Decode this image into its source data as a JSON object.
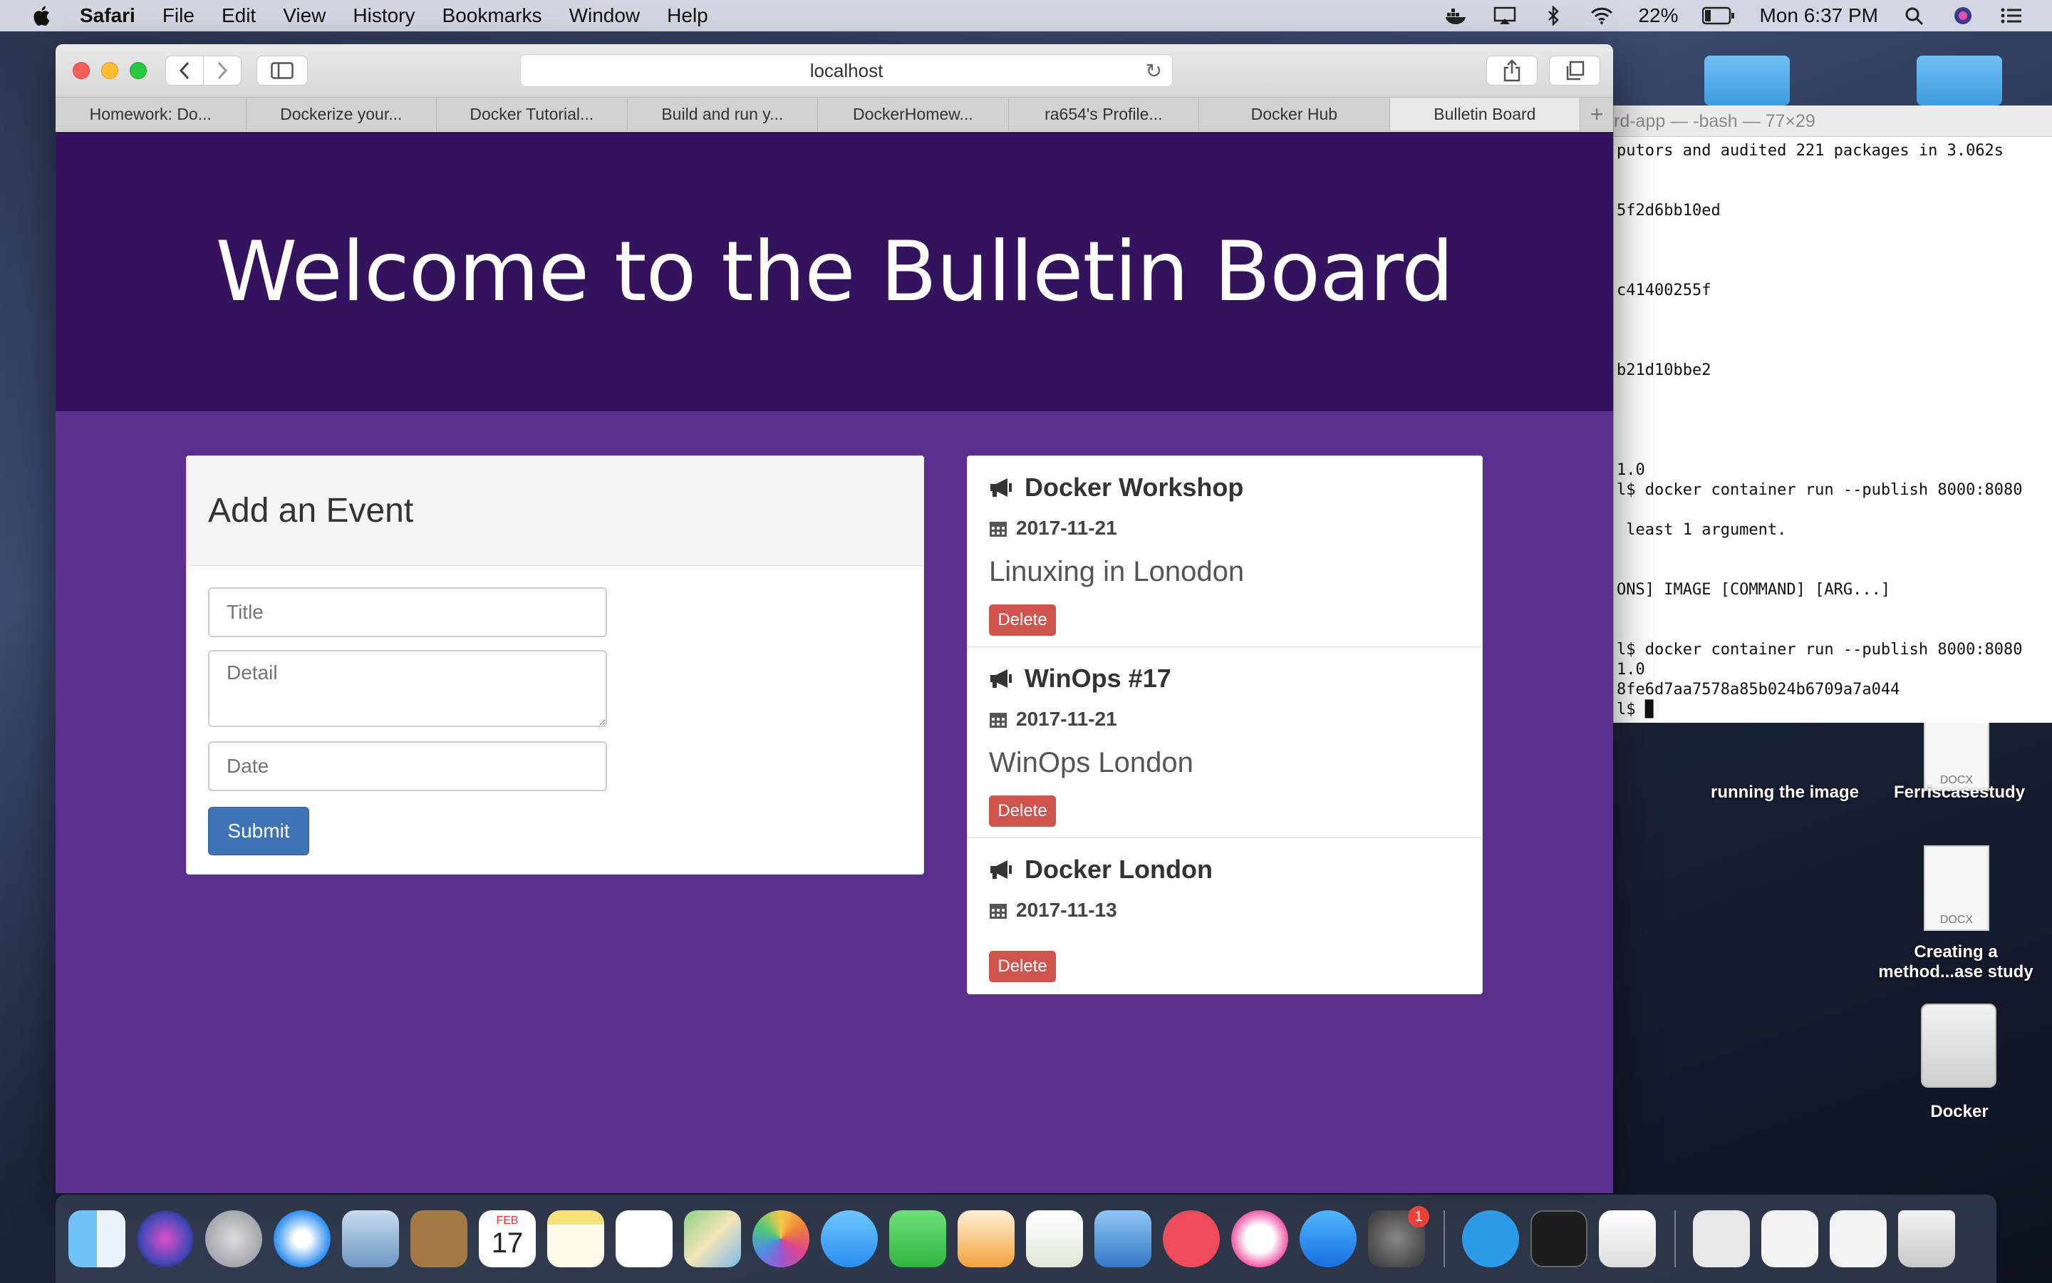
{
  "menubar": {
    "app_name": "Safari",
    "items": [
      "File",
      "Edit",
      "View",
      "History",
      "Bookmarks",
      "Window",
      "Help"
    ],
    "battery": "22%",
    "clock": "Mon 6:37 PM"
  },
  "desktop": {
    "items": [
      "running the image",
      "Ferriscasestudy",
      "Creating a method...ase study",
      "Docker"
    ],
    "docx_label": "DOCX"
  },
  "terminal": {
    "title": "rd-app — -bash — 77×29",
    "lines": [
      "putors and audited 221 packages in 3.062s",
      "",
      "",
      "5f2d6bb10ed",
      "",
      "",
      "",
      "c41400255f",
      "",
      "",
      "",
      "b21d10bbe2",
      "",
      "",
      "",
      "",
      "1.0",
      "l$ docker container run --publish 8000:8080",
      "",
      " least 1 argument.",
      "",
      "",
      "ONS] IMAGE [COMMAND] [ARG...]",
      "",
      "",
      "l$ docker container run --publish 8000:8080",
      "1.0",
      "8fe6d7aa7578a85b024b6709a7a044",
      "l$ "
    ]
  },
  "safari": {
    "url": "localhost",
    "tabs": [
      "Homework: Do...",
      "Dockerize your...",
      "Docker Tutorial...",
      "Build and run y...",
      "DockerHomew...",
      "ra654's Profile...",
      "Docker Hub",
      "Bulletin Board"
    ],
    "active_tab": "Bulletin Board"
  },
  "page": {
    "hero_title": "Welcome to the Bulletin Board",
    "form": {
      "heading": "Add an Event",
      "title_placeholder": "Title",
      "detail_placeholder": "Detail",
      "date_placeholder": "Date",
      "submit_label": "Submit"
    },
    "events": [
      {
        "title": "Docker Workshop",
        "date": "2017-11-21",
        "detail": "Linuxing in Lonodon",
        "delete_label": "Delete"
      },
      {
        "title": "WinOps #17",
        "date": "2017-11-21",
        "detail": "WinOps London",
        "delete_label": "Delete"
      },
      {
        "title": "Docker London",
        "date": "2017-11-13",
        "detail": "",
        "delete_label": "Delete"
      }
    ]
  },
  "dock": {
    "apps": [
      "finder-icon",
      "siri-icon",
      "launchpad-icon",
      "safari-icon",
      "mail-icon",
      "contacts-icon",
      "calendar-icon",
      "notes-icon",
      "reminders-icon",
      "maps-icon",
      "photos-icon",
      "messages-icon",
      "facetime-icon",
      "pages-icon",
      "numbers-icon",
      "keynote-icon",
      "news-icon",
      "itunes-icon",
      "app-store-icon",
      "system-preferences-icon",
      "docker-icon",
      "terminal-icon",
      "textedit-icon"
    ],
    "calendar_month": "FEB",
    "calendar_day": "17",
    "system_prefs_badge": "1"
  },
  "colors": {
    "hero_bg": "#33135e",
    "page_bg": "#5b2f8e",
    "submit_bg": "#3e73b5",
    "delete_bg": "#d0534d"
  }
}
